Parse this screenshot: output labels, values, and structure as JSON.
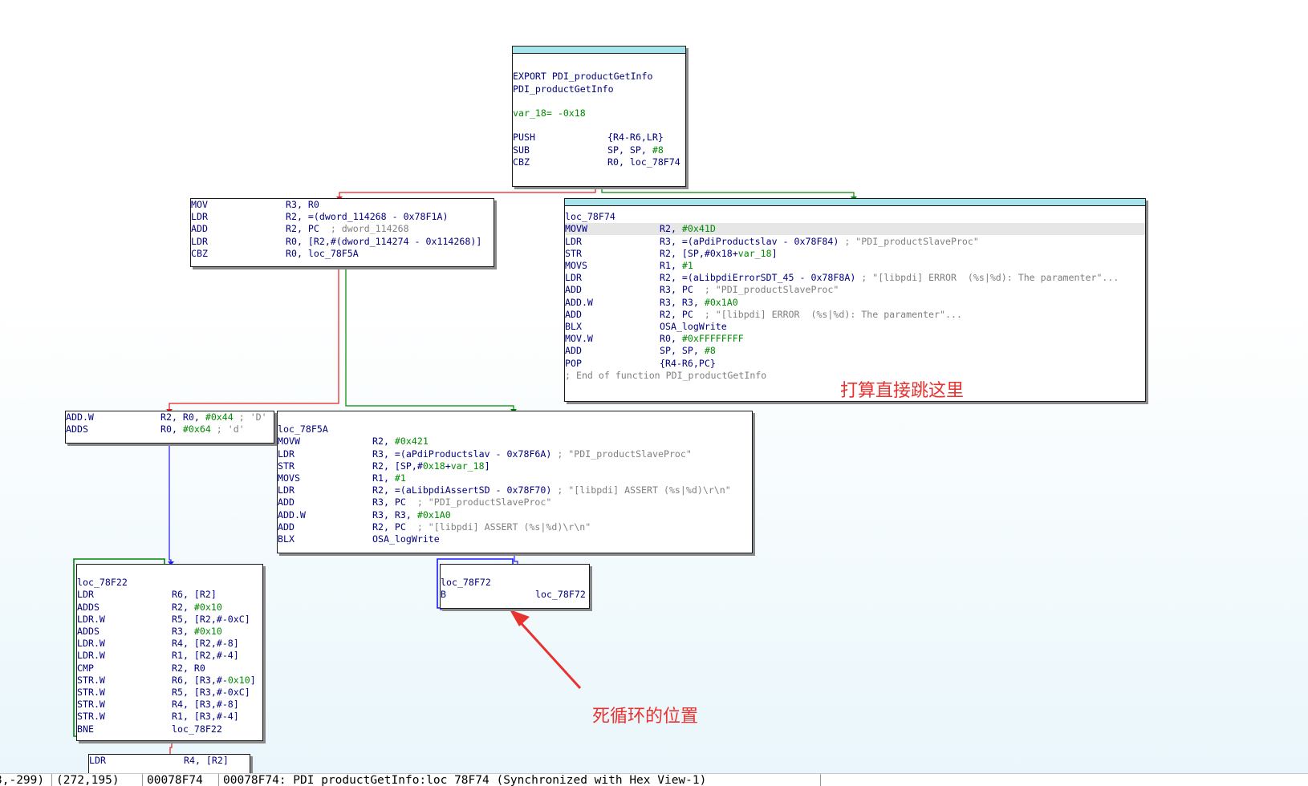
{
  "blocks": [
    {
      "id": "entry",
      "lines": [
        {
          "t": "blank"
        },
        {
          "t": "blank"
        },
        {
          "t": "label",
          "text": "EXPORT PDI_productGetInfo"
        },
        {
          "t": "label",
          "text": "PDI_productGetInfo"
        },
        {
          "t": "blank"
        },
        {
          "t": "green",
          "text": "var_18= -0x18"
        },
        {
          "t": "blank"
        },
        {
          "t": "ins",
          "m": "PUSH",
          "ops": [
            {
              "c": "n",
              "s": "{R4-R6,LR}"
            }
          ]
        },
        {
          "t": "ins",
          "m": "SUB",
          "ops": [
            {
              "c": "n",
              "s": "SP, SP, "
            },
            {
              "c": "g",
              "s": "#8"
            }
          ]
        },
        {
          "t": "ins",
          "m": "CBZ",
          "ops": [
            {
              "c": "n",
              "s": "R0, loc_78F74"
            }
          ]
        }
      ]
    },
    {
      "id": "block2",
      "lines": [
        {
          "t": "ins",
          "m": "MOV",
          "ops": [
            {
              "c": "n",
              "s": "R3, R0"
            }
          ]
        },
        {
          "t": "ins",
          "m": "LDR",
          "ops": [
            {
              "c": "n",
              "s": "R2, =(dword_114268 - 0x78F1A)"
            }
          ]
        },
        {
          "t": "ins",
          "m": "ADD",
          "ops": [
            {
              "c": "n",
              "s": "R2, PC  "
            },
            {
              "c": "c",
              "s": "; dword_114268"
            }
          ]
        },
        {
          "t": "ins",
          "m": "LDR",
          "ops": [
            {
              "c": "n",
              "s": "R0, [R2,#(dword_114274 - 0x114268)]"
            }
          ]
        },
        {
          "t": "ins",
          "m": "CBZ",
          "ops": [
            {
              "c": "n",
              "s": "R0, loc_78F5A"
            }
          ]
        }
      ]
    },
    {
      "id": "error-block",
      "lines": [
        {
          "t": "blank"
        },
        {
          "t": "label",
          "text": "loc_78F74"
        },
        {
          "t": "ins",
          "hl": true,
          "m": "MOVW",
          "ops": [
            {
              "c": "n",
              "s": "R2, "
            },
            {
              "c": "g",
              "s": "#0x41D"
            }
          ]
        },
        {
          "t": "ins",
          "m": "LDR",
          "ops": [
            {
              "c": "n",
              "s": "R3, =(aPdiProductslav - 0x78F84) "
            },
            {
              "c": "c",
              "s": "; \"PDI_productSlaveProc\""
            }
          ]
        },
        {
          "t": "ins",
          "m": "STR",
          "ops": [
            {
              "c": "n",
              "s": "R2, [SP,#0x18+"
            },
            {
              "c": "g",
              "s": "var_18"
            },
            {
              "c": "n",
              "s": "]"
            }
          ]
        },
        {
          "t": "ins",
          "m": "MOVS",
          "ops": [
            {
              "c": "n",
              "s": "R1, "
            },
            {
              "c": "g",
              "s": "#1"
            }
          ]
        },
        {
          "t": "ins",
          "m": "LDR",
          "ops": [
            {
              "c": "n",
              "s": "R2, =(aLibpdiErrorSDT_45 - 0x78F8A) "
            },
            {
              "c": "c",
              "s": "; \"[libpdi] ERROR  (%s|%d): The paramenter\"..."
            }
          ]
        },
        {
          "t": "ins",
          "m": "ADD",
          "ops": [
            {
              "c": "n",
              "s": "R3, PC  "
            },
            {
              "c": "c",
              "s": "; \"PDI_productSlaveProc\""
            }
          ]
        },
        {
          "t": "ins",
          "m": "ADD.W",
          "ops": [
            {
              "c": "n",
              "s": "R3, R3, "
            },
            {
              "c": "g",
              "s": "#0x1A0"
            }
          ]
        },
        {
          "t": "ins",
          "m": "ADD",
          "ops": [
            {
              "c": "n",
              "s": "R2, PC  "
            },
            {
              "c": "c",
              "s": "; \"[libpdi] ERROR  (%s|%d): The paramenter\"..."
            }
          ]
        },
        {
          "t": "ins",
          "m": "BLX",
          "ops": [
            {
              "c": "n",
              "s": "OSA_logWrite"
            }
          ]
        },
        {
          "t": "ins",
          "m": "MOV.W",
          "ops": [
            {
              "c": "n",
              "s": "R0, "
            },
            {
              "c": "g",
              "s": "#0xFFFFFFFF"
            }
          ]
        },
        {
          "t": "ins",
          "m": "ADD",
          "ops": [
            {
              "c": "n",
              "s": "SP, SP, "
            },
            {
              "c": "g",
              "s": "#8"
            }
          ]
        },
        {
          "t": "ins",
          "m": "POP",
          "ops": [
            {
              "c": "n",
              "s": "{R4-R6,PC}"
            }
          ]
        },
        {
          "t": "comment",
          "text": "; End of function PDI_productGetInfo"
        }
      ]
    },
    {
      "id": "block3",
      "lines": [
        {
          "t": "ins",
          "m": "ADD.W",
          "ops": [
            {
              "c": "n",
              "s": "R2, R0, "
            },
            {
              "c": "g",
              "s": "#0x44"
            },
            {
              "c": "c",
              "s": " ; 'D'"
            }
          ]
        },
        {
          "t": "ins",
          "m": "ADDS",
          "ops": [
            {
              "c": "n",
              "s": "R0, "
            },
            {
              "c": "g",
              "s": "#0x64"
            },
            {
              "c": "c",
              "s": " ; 'd'"
            }
          ]
        }
      ]
    },
    {
      "id": "assert-block",
      "lines": [
        {
          "t": "blank"
        },
        {
          "t": "label",
          "text": "loc_78F5A"
        },
        {
          "t": "ins",
          "m": "MOVW",
          "ops": [
            {
              "c": "n",
              "s": "R2, "
            },
            {
              "c": "g",
              "s": "#0x421"
            }
          ]
        },
        {
          "t": "ins",
          "m": "LDR",
          "ops": [
            {
              "c": "n",
              "s": "R3, =(aPdiProductslav - 0x78F6A) "
            },
            {
              "c": "c",
              "s": "; \"PDI_productSlaveProc\""
            }
          ]
        },
        {
          "t": "ins",
          "m": "STR",
          "ops": [
            {
              "c": "n",
              "s": "R2, [SP,#"
            },
            {
              "c": "g",
              "s": "0x18"
            },
            {
              "c": "n",
              "s": "+"
            },
            {
              "c": "g",
              "s": "var_18"
            },
            {
              "c": "n",
              "s": "]"
            }
          ]
        },
        {
          "t": "ins",
          "m": "MOVS",
          "ops": [
            {
              "c": "n",
              "s": "R1, "
            },
            {
              "c": "g",
              "s": "#1"
            }
          ]
        },
        {
          "t": "ins",
          "m": "LDR",
          "ops": [
            {
              "c": "n",
              "s": "R2, =(aLibpdiAssertSD - 0x78F70) "
            },
            {
              "c": "c",
              "s": "; \"[libpdi] ASSERT (%s|%d)\\r\\n\""
            }
          ]
        },
        {
          "t": "ins",
          "m": "ADD",
          "ops": [
            {
              "c": "n",
              "s": "R3, PC  "
            },
            {
              "c": "c",
              "s": "; \"PDI_productSlaveProc\""
            }
          ]
        },
        {
          "t": "ins",
          "m": "ADD.W",
          "ops": [
            {
              "c": "n",
              "s": "R3, R3, "
            },
            {
              "c": "g",
              "s": "#0x1A0"
            }
          ]
        },
        {
          "t": "ins",
          "m": "ADD",
          "ops": [
            {
              "c": "n",
              "s": "R2, PC  "
            },
            {
              "c": "c",
              "s": "; \"[libpdi] ASSERT (%s|%d)\\r\\n\""
            }
          ]
        },
        {
          "t": "ins",
          "m": "BLX",
          "ops": [
            {
              "c": "n",
              "s": "OSA_logWrite"
            }
          ]
        }
      ]
    },
    {
      "id": "loop-block",
      "lines": [
        {
          "t": "blank"
        },
        {
          "t": "label",
          "text": "loc_78F22"
        },
        {
          "t": "ins",
          "m": "LDR",
          "ops": [
            {
              "c": "n",
              "s": "R6, [R2]"
            }
          ]
        },
        {
          "t": "ins",
          "m": "ADDS",
          "ops": [
            {
              "c": "n",
              "s": "R2, "
            },
            {
              "c": "g",
              "s": "#0x10"
            }
          ]
        },
        {
          "t": "ins",
          "m": "LDR.W",
          "ops": [
            {
              "c": "n",
              "s": "R5, [R2,#-0xC]"
            }
          ]
        },
        {
          "t": "ins",
          "m": "ADDS",
          "ops": [
            {
              "c": "n",
              "s": "R3, "
            },
            {
              "c": "g",
              "s": "#0x10"
            }
          ]
        },
        {
          "t": "ins",
          "m": "LDR.W",
          "ops": [
            {
              "c": "n",
              "s": "R4, [R2,#-8]"
            }
          ]
        },
        {
          "t": "ins",
          "m": "LDR.W",
          "ops": [
            {
              "c": "n",
              "s": "R1, [R2,#-4]"
            }
          ]
        },
        {
          "t": "ins",
          "m": "CMP",
          "ops": [
            {
              "c": "n",
              "s": "R2, R0"
            }
          ]
        },
        {
          "t": "ins",
          "m": "STR.W",
          "ops": [
            {
              "c": "n",
              "s": "R6, [R3,#-"
            },
            {
              "c": "g",
              "s": "0x10"
            },
            {
              "c": "n",
              "s": "]"
            }
          ]
        },
        {
          "t": "ins",
          "m": "STR.W",
          "ops": [
            {
              "c": "n",
              "s": "R5, [R3,#-0xC]"
            }
          ]
        },
        {
          "t": "ins",
          "m": "STR.W",
          "ops": [
            {
              "c": "n",
              "s": "R4, [R3,#-8]"
            }
          ]
        },
        {
          "t": "ins",
          "m": "STR.W",
          "ops": [
            {
              "c": "n",
              "s": "R1, [R3,#-4]"
            }
          ]
        },
        {
          "t": "ins",
          "m": "BNE",
          "ops": [
            {
              "c": "n",
              "s": "loc_78F22"
            }
          ]
        }
      ]
    },
    {
      "id": "infinite-loop-block",
      "lines": [
        {
          "t": "blank"
        },
        {
          "t": "label",
          "text": "loc_78F72"
        },
        {
          "t": "ins",
          "m": "B",
          "ops": [
            {
              "c": "n",
              "s": "loc_78F72"
            }
          ]
        }
      ]
    },
    {
      "id": "partial-block",
      "lines": [
        {
          "t": "ins",
          "m": "LDR",
          "ops": [
            {
              "c": "n",
              "s": "R4, [R2]"
            }
          ]
        }
      ]
    }
  ],
  "annotations": {
    "jump_here": "打算直接跳这里",
    "dead_loop": "死循环的位置"
  },
  "status": {
    "cell1": "3,-299)",
    "cell2": "(272,195)",
    "cell3": "00078F74",
    "cell4": "00078F74: PDI_productGetInfo:loc_78F74 (Synchronized with Hex View-1)"
  },
  "colors": {
    "edge_true": "#008a00",
    "edge_false": "#e02020",
    "edge_uncond": "#1a1aff",
    "annotation": "#e8322f",
    "block_header": "#a9e4ec"
  }
}
